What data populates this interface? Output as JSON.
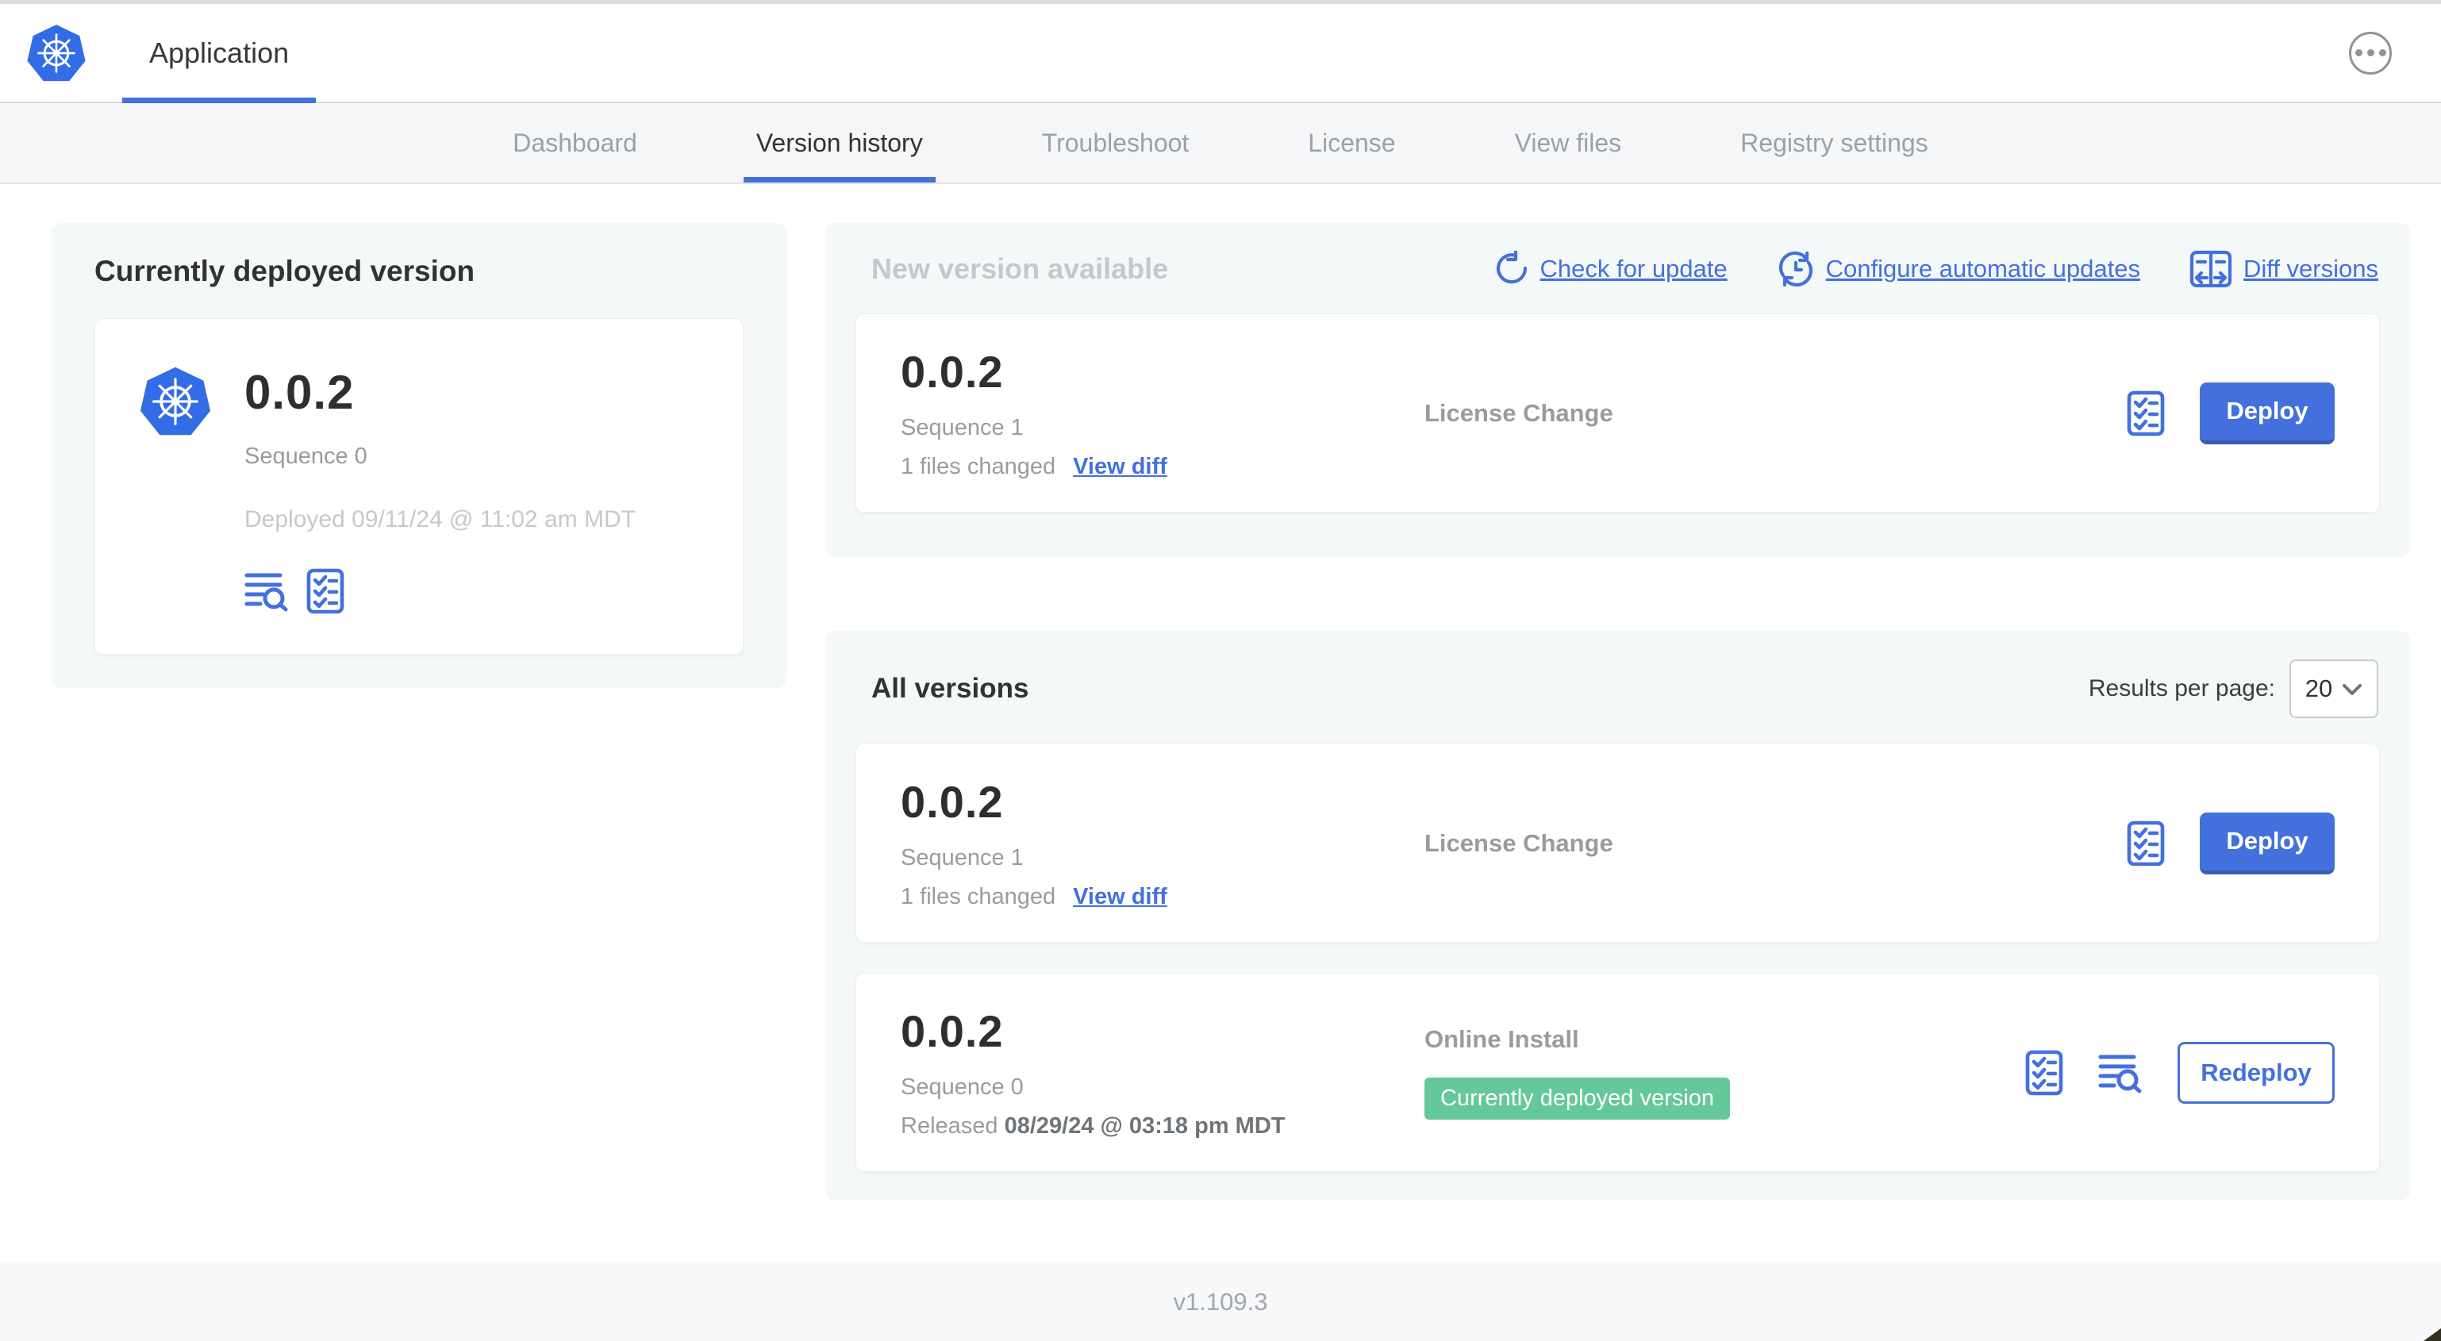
{
  "colors": {
    "accent_blue": "#4370dc",
    "logo_blue": "#326de6",
    "badge_green": "#65c89a",
    "muted_gray": "#9b9b9b",
    "light_gray_text": "#c6c9cc",
    "panel_gray": "#f5f8f9"
  },
  "header": {
    "app_tab": "Application"
  },
  "nav": {
    "tabs": [
      {
        "label": "Dashboard",
        "active": false
      },
      {
        "label": "Version history",
        "active": true
      },
      {
        "label": "Troubleshoot",
        "active": false
      },
      {
        "label": "License",
        "active": false
      },
      {
        "label": "View files",
        "active": false
      },
      {
        "label": "Registry settings",
        "active": false
      }
    ]
  },
  "current_version_card": {
    "title": "Currently deployed version",
    "version": "0.0.2",
    "sequence": "Sequence 0",
    "deployed_at": "Deployed 09/11/24 @ 11:02 am MDT"
  },
  "new_version_section": {
    "title": "New version available",
    "links": {
      "check": "Check for update",
      "configure": "Configure automatic updates",
      "diff": "Diff versions"
    },
    "row": {
      "version": "0.0.2",
      "sequence": "Sequence 1",
      "files_changed": "1 files changed",
      "view_diff": "View diff",
      "source": "License Change",
      "action_label": "Deploy"
    }
  },
  "all_versions_section": {
    "title": "All versions",
    "results_per_page_label": "Results per page:",
    "results_per_page_value": "20",
    "rows": [
      {
        "version": "0.0.2",
        "sequence": "Sequence 1",
        "files_changed": "1 files changed",
        "view_diff": "View diff",
        "source": "License Change",
        "action_label": "Deploy"
      },
      {
        "version": "0.0.2",
        "sequence": "Sequence 0",
        "released_label": "Released",
        "released_date": "08/29/24 @ 03:18 pm MDT",
        "source": "Online Install",
        "badge": "Currently deployed version",
        "action_label": "Redeploy"
      }
    ]
  },
  "footer": {
    "version": "v1.109.3"
  }
}
